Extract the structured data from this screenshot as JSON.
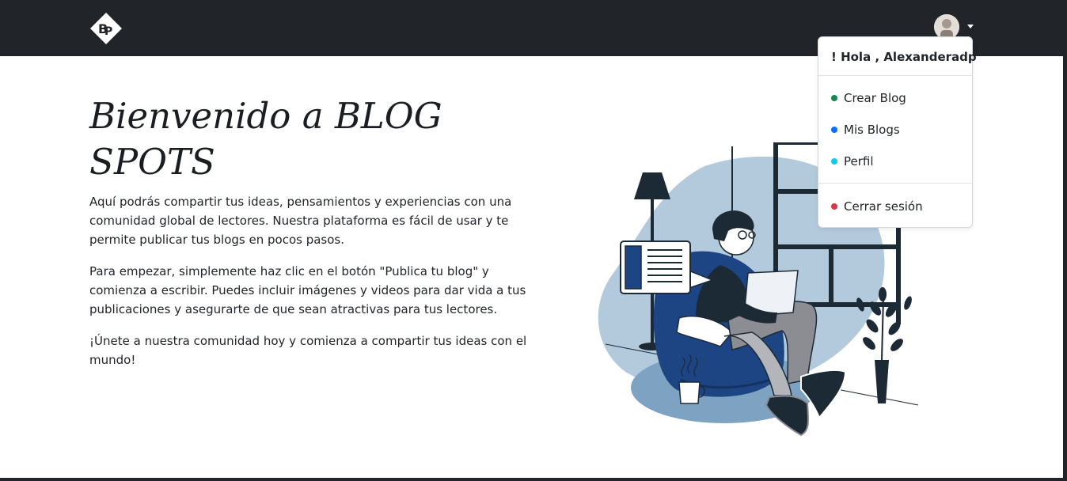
{
  "navbar": {
    "logo_alt": "BP",
    "user_menu": {
      "greeting": "! Hola , Alexanderadp",
      "items": [
        {
          "label": "Crear Blog",
          "dot_color": "#198754"
        },
        {
          "label": "Mis Blogs",
          "dot_color": "#0d6efd"
        },
        {
          "label": "Perfil",
          "dot_color": "#0dcaf0"
        }
      ],
      "logout": {
        "label": "Cerrar sesión",
        "dot_color": "#dc3545"
      }
    }
  },
  "hero": {
    "title": "Bienvenido a BLOG SPOTS",
    "paragraphs": [
      "Aquí podrás compartir tus ideas, pensamientos y experiencias con una comunidad global de lectores. Nuestra plataforma es fácil de usar y te permite publicar tus blogs en pocos pasos.",
      "Para empezar, simplemente haz clic en el botón \"Publica tu blog\" y comienza a escribir. Puedes incluir imágenes y videos para dar vida a tus publicaciones y asegurarte de que sean atractivas para tus lectores.",
      "¡Únete a nuestra comunidad hoy y comienza a compartir tus ideas con el mundo!"
    ]
  },
  "colors": {
    "navbar_bg": "#212529",
    "blob": "#b3cadc",
    "chair": "#1d4583",
    "ink": "#1c2a36"
  }
}
